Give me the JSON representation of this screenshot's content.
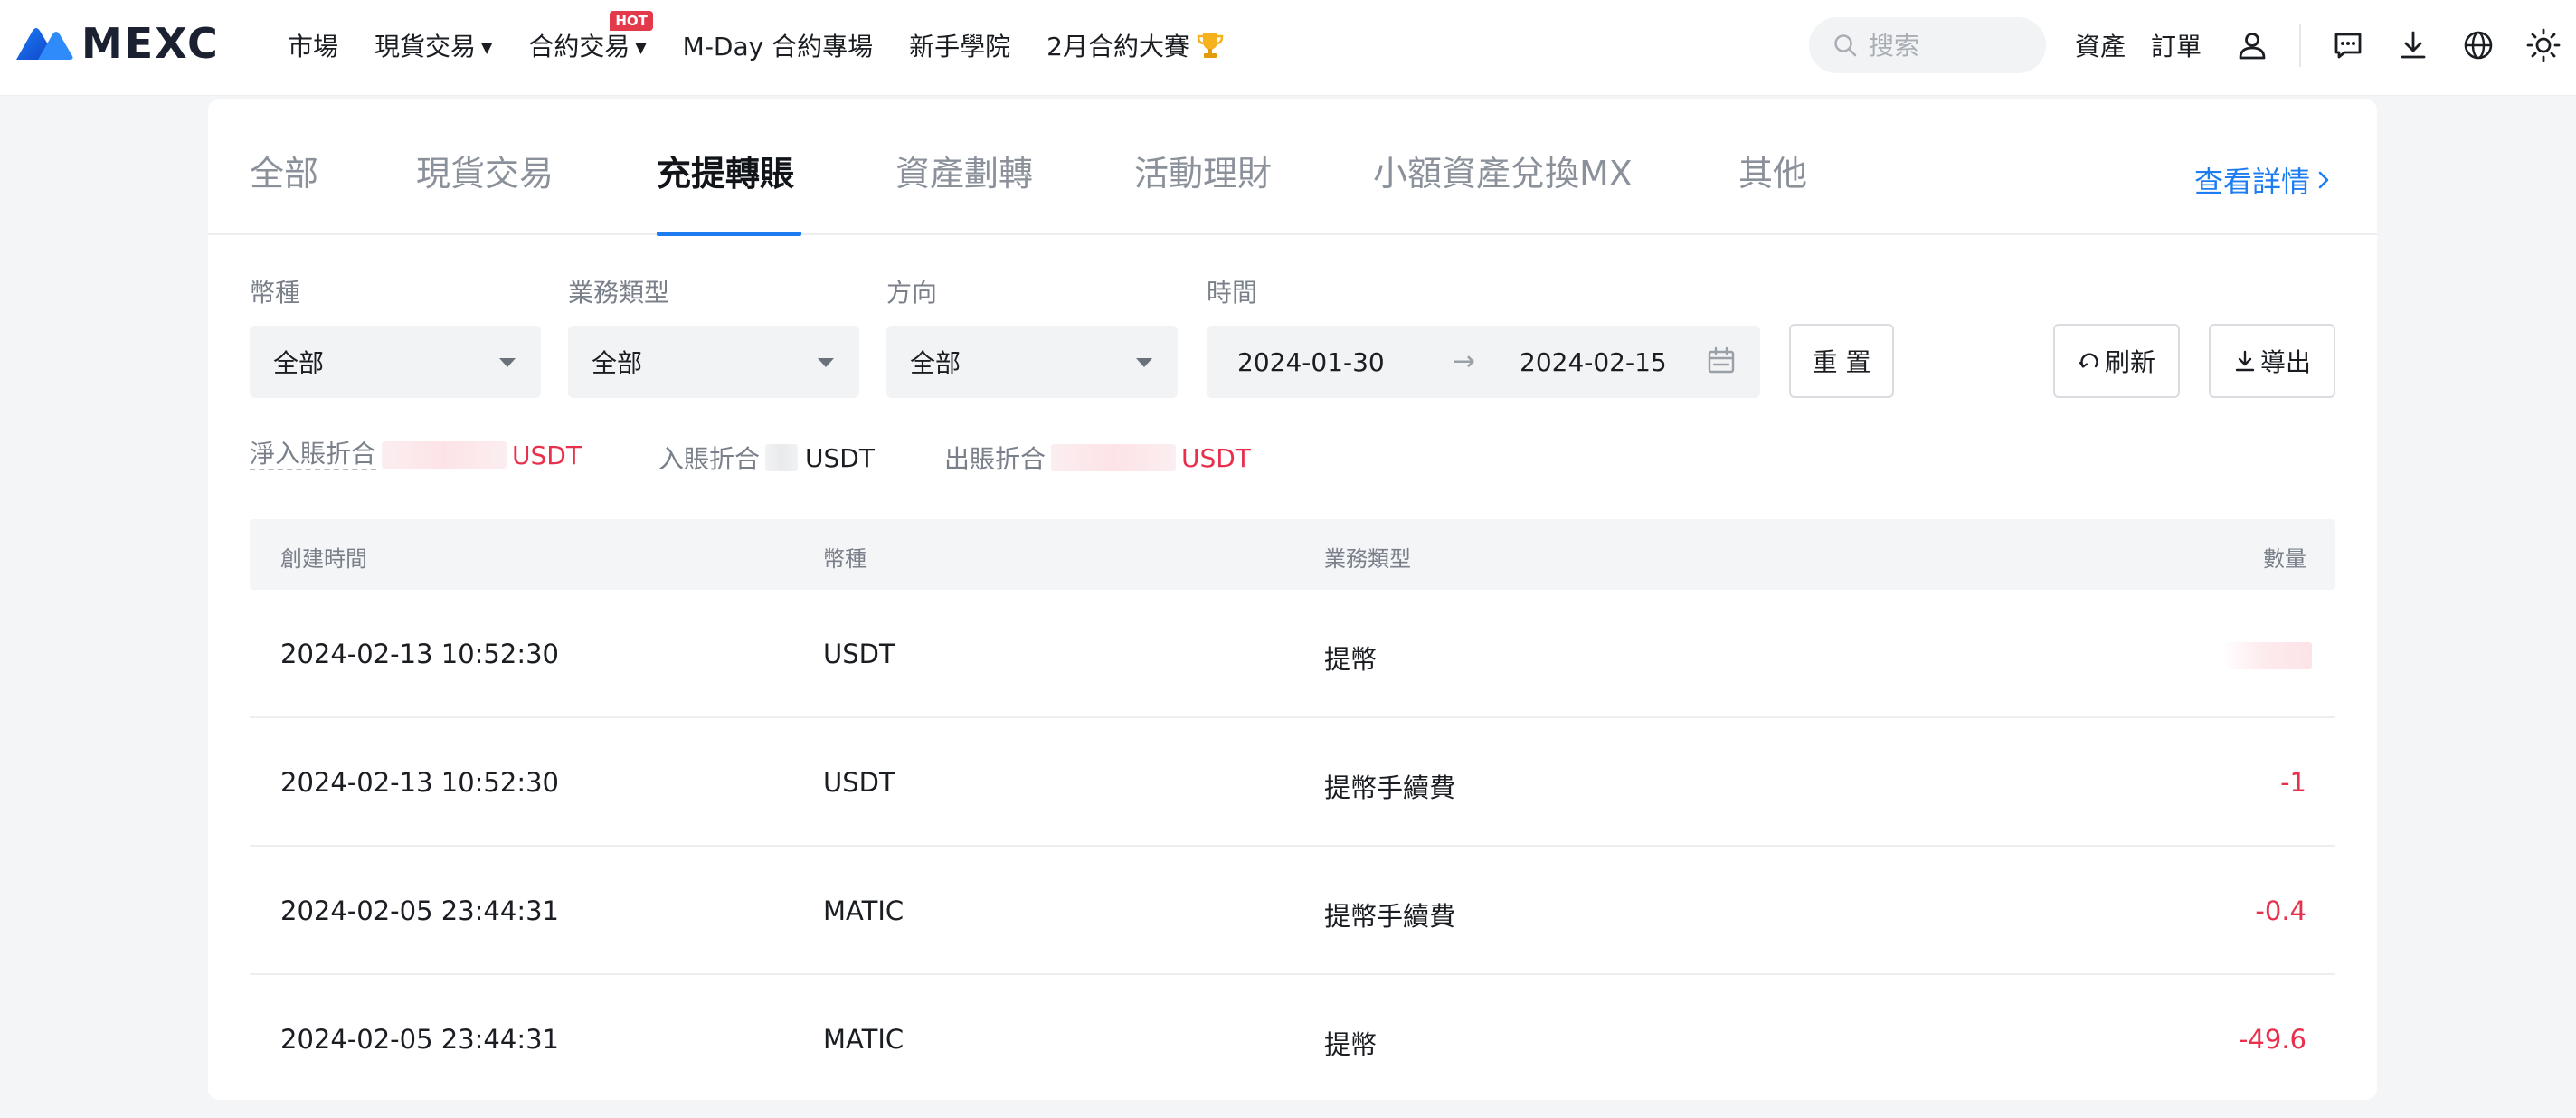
{
  "brand": {
    "name": "MEXC",
    "color": "#1d7cf2"
  },
  "topnav": {
    "items": [
      {
        "label": "市場",
        "has_caret": false
      },
      {
        "label": "現貨交易",
        "has_caret": true
      },
      {
        "label": "合約交易",
        "has_caret": true,
        "badge": "HOT"
      },
      {
        "label": "M-Day 合約專場",
        "has_caret": false
      },
      {
        "label": "新手學院",
        "has_caret": false
      },
      {
        "label": "2月合約大賽",
        "has_caret": false,
        "icon": "trophy-icon"
      }
    ],
    "search_placeholder": "搜索",
    "right_links": [
      "資產",
      "訂單"
    ],
    "icons": [
      "user-icon",
      "message-icon",
      "download-icon",
      "globe-icon",
      "sun-icon"
    ]
  },
  "tabs": {
    "items": [
      "全部",
      "現貨交易",
      "充提轉賬",
      "資產劃轉",
      "活動理財",
      "小額資產兌換MX",
      "其他"
    ],
    "active": "充提轉賬",
    "details_link": "查看詳情"
  },
  "filters": {
    "currency": {
      "label": "幣種",
      "value": "全部"
    },
    "business_type": {
      "label": "業務類型",
      "value": "全部"
    },
    "direction": {
      "label": "方向",
      "value": "全部"
    },
    "time": {
      "label": "時間",
      "start": "2024-01-30",
      "end": "2024-02-15",
      "arrow": "→"
    },
    "reset_label": "重 置",
    "refresh_label": "刷新",
    "export_label": "導出"
  },
  "summary": {
    "net_in": {
      "label": "淨入賬折合",
      "currency": "USDT"
    },
    "in": {
      "label": "入賬折合",
      "currency": "USDT"
    },
    "out": {
      "label": "出賬折合",
      "currency": "USDT"
    }
  },
  "table": {
    "headers": [
      "創建時間",
      "幣種",
      "業務類型",
      "數量"
    ],
    "rows": [
      {
        "time": "2024-02-13 10:52:30",
        "currency": "USDT",
        "type": "提幣",
        "amount": ""
      },
      {
        "time": "2024-02-13 10:52:30",
        "currency": "USDT",
        "type": "提幣手續費",
        "amount": "-1"
      },
      {
        "time": "2024-02-05 23:44:31",
        "currency": "MATIC",
        "type": "提幣手續費",
        "amount": "-0.4"
      },
      {
        "time": "2024-02-05 23:44:31",
        "currency": "MATIC",
        "type": "提幣",
        "amount": "-49.6"
      }
    ]
  },
  "colors": {
    "negative": "#e8304c",
    "accent": "#1d7cf2",
    "hot_badge": "#e23a4b"
  }
}
